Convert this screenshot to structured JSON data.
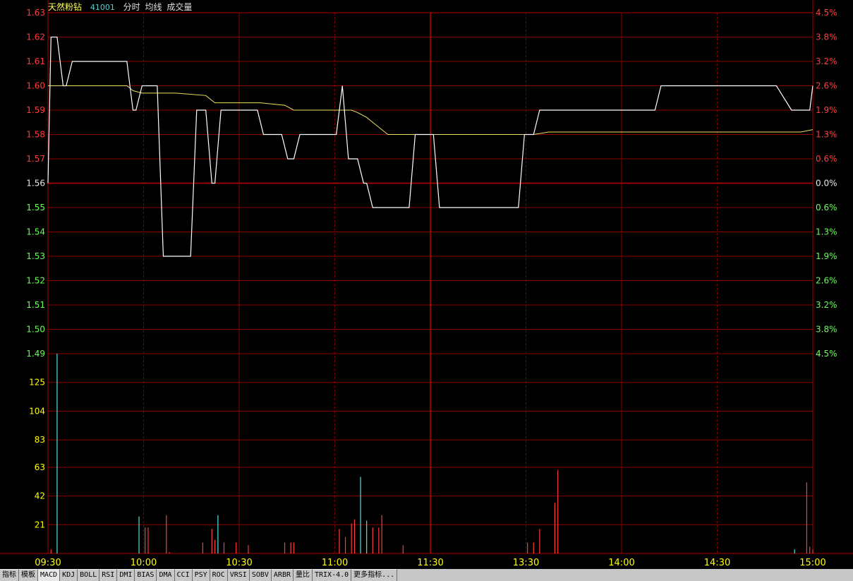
{
  "header": {
    "stock_name": "天然粉钻",
    "code": "41001",
    "labels": [
      "分时",
      "均线",
      "成交量"
    ]
  },
  "colors": {
    "background": "#000000",
    "grid": "#8c0000",
    "frame": "#b00000",
    "price_line": "#ffffff",
    "avg_line": "#f0e060",
    "up": "#ff3c3c",
    "down": "#66ff55",
    "neutral": "#e8e8e8",
    "volume_label": "#ffff00",
    "time_label": "#ffff00",
    "vol_up": "#ff3c3c",
    "vol_down": "#55e0e0"
  },
  "tabs": [
    "指标",
    "模板",
    "MACD",
    "KDJ",
    "BOLL",
    "RSI",
    "DMI",
    "BIAS",
    "DMA",
    "CCI",
    "PSY",
    "ROC",
    "VRSI",
    "SOBV",
    "ARBR",
    "量比",
    "TRIX-4.0",
    "更多指标..."
  ],
  "chart_data": {
    "type": "line",
    "title": "",
    "price_axis": {
      "ticks": [
        "1.63",
        "1.62",
        "1.61",
        "1.60",
        "1.59",
        "1.58",
        "1.57",
        "1.56",
        "1.55",
        "1.54",
        "1.53",
        "1.52",
        "1.51",
        "1.50",
        "1.49"
      ],
      "min": 1.49,
      "max": 1.63,
      "prev_close": 1.56
    },
    "pct_axis": {
      "ticks": [
        "4.5%",
        "3.8%",
        "3.2%",
        "2.6%",
        "1.9%",
        "1.3%",
        "0.6%",
        "0.0%",
        "0.6%",
        "1.3%",
        "1.9%",
        "2.6%",
        "3.2%",
        "3.8%",
        "4.5%"
      ]
    },
    "volume_axis": {
      "ticks": [
        "125",
        "104",
        "83",
        "63",
        "42",
        "21"
      ],
      "max": 146
    },
    "time_axis": {
      "labels": [
        "09:30",
        "10:00",
        "10:30",
        "11:00",
        "11:30",
        "13:30",
        "14:00",
        "14:30",
        "15:00"
      ],
      "total_minutes": 240
    },
    "series": [
      {
        "key": "price",
        "points": [
          [
            0,
            1.56
          ],
          [
            1,
            1.62
          ],
          [
            3,
            1.62
          ],
          [
            5,
            1.6
          ],
          [
            6,
            1.6
          ],
          [
            8,
            1.61
          ],
          [
            26,
            1.61
          ],
          [
            28,
            1.59
          ],
          [
            29,
            1.59
          ],
          [
            31,
            1.6
          ],
          [
            36,
            1.6
          ],
          [
            38,
            1.53
          ],
          [
            47,
            1.53
          ],
          [
            49,
            1.59
          ],
          [
            52,
            1.59
          ],
          [
            54,
            1.56
          ],
          [
            55,
            1.56
          ],
          [
            57,
            1.59
          ],
          [
            69,
            1.59
          ],
          [
            71,
            1.58
          ],
          [
            77,
            1.58
          ],
          [
            79,
            1.57
          ],
          [
            81,
            1.57
          ],
          [
            83,
            1.58
          ],
          [
            95,
            1.58
          ],
          [
            97,
            1.6
          ],
          [
            99,
            1.57
          ],
          [
            102,
            1.57
          ],
          [
            104,
            1.56
          ],
          [
            105,
            1.56
          ],
          [
            107,
            1.55
          ],
          [
            119,
            1.55
          ],
          [
            121,
            1.58
          ],
          [
            127,
            1.58
          ],
          [
            129,
            1.55
          ],
          [
            155,
            1.55
          ],
          [
            157,
            1.58
          ],
          [
            160,
            1.58
          ],
          [
            162,
            1.59
          ],
          [
            200,
            1.59
          ],
          [
            202,
            1.6
          ],
          [
            240,
            1.6
          ],
          [
            245,
            1.59
          ],
          [
            251,
            1.59
          ],
          [
            252,
            1.6
          ]
        ]
      },
      {
        "key": "average",
        "points": [
          [
            0,
            1.6
          ],
          [
            3,
            1.6
          ],
          [
            26,
            1.6
          ],
          [
            28,
            1.598
          ],
          [
            31,
            1.597
          ],
          [
            36,
            1.597
          ],
          [
            42,
            1.597
          ],
          [
            52,
            1.596
          ],
          [
            55,
            1.593
          ],
          [
            60,
            1.593
          ],
          [
            70,
            1.593
          ],
          [
            78,
            1.592
          ],
          [
            81,
            1.59
          ],
          [
            95,
            1.59
          ],
          [
            100,
            1.59
          ],
          [
            102,
            1.589
          ],
          [
            105,
            1.587
          ],
          [
            107,
            1.585
          ],
          [
            110,
            1.582
          ],
          [
            112,
            1.58
          ],
          [
            127,
            1.58
          ],
          [
            160,
            1.58
          ],
          [
            165,
            1.581
          ],
          [
            200,
            1.581
          ],
          [
            248,
            1.581
          ],
          [
            252,
            1.582
          ]
        ]
      }
    ],
    "volume": [
      {
        "t": 1,
        "v": 3,
        "dir": "up"
      },
      {
        "t": 3,
        "v": 146,
        "dir": "down"
      },
      {
        "t": 30,
        "v": 27,
        "dir": "down"
      },
      {
        "t": 32,
        "v": 19,
        "dir": "up"
      },
      {
        "t": 33,
        "v": 19,
        "dir": "up"
      },
      {
        "t": 39,
        "v": 28,
        "dir": "up"
      },
      {
        "t": 40,
        "v": 1,
        "dir": "up"
      },
      {
        "t": 51,
        "v": 8,
        "dir": "up"
      },
      {
        "t": 54,
        "v": 18,
        "dir": "up"
      },
      {
        "t": 55,
        "v": 10,
        "dir": "up"
      },
      {
        "t": 56,
        "v": 28,
        "dir": "down"
      },
      {
        "t": 58,
        "v": 8,
        "dir": "up"
      },
      {
        "t": 62,
        "v": 8,
        "dir": "up"
      },
      {
        "t": 66,
        "v": 6,
        "dir": "up"
      },
      {
        "t": 78,
        "v": 8,
        "dir": "up"
      },
      {
        "t": 80,
        "v": 8,
        "dir": "up"
      },
      {
        "t": 81,
        "v": 8,
        "dir": "up"
      },
      {
        "t": 96,
        "v": 18,
        "dir": "up"
      },
      {
        "t": 98,
        "v": 12,
        "dir": "up"
      },
      {
        "t": 100,
        "v": 22,
        "dir": "up"
      },
      {
        "t": 101,
        "v": 25,
        "dir": "up"
      },
      {
        "t": 103,
        "v": 56,
        "dir": "down"
      },
      {
        "t": 105,
        "v": 24,
        "dir": "down"
      },
      {
        "t": 107,
        "v": 19,
        "dir": "up"
      },
      {
        "t": 109,
        "v": 19,
        "dir": "up"
      },
      {
        "t": 110,
        "v": 28,
        "dir": "up"
      },
      {
        "t": 117,
        "v": 6,
        "dir": "up"
      },
      {
        "t": 158,
        "v": 8,
        "dir": "up"
      },
      {
        "t": 160,
        "v": 8,
        "dir": "up"
      },
      {
        "t": 162,
        "v": 18,
        "dir": "up"
      },
      {
        "t": 167,
        "v": 37,
        "dir": "up"
      },
      {
        "t": 168,
        "v": 61,
        "dir": "up"
      },
      {
        "t": 246,
        "v": 3,
        "dir": "down"
      },
      {
        "t": 250,
        "v": 52,
        "dir": "up"
      },
      {
        "t": 251,
        "v": 5,
        "dir": "up"
      },
      {
        "t": 252,
        "v": 3,
        "dir": "up"
      }
    ]
  }
}
